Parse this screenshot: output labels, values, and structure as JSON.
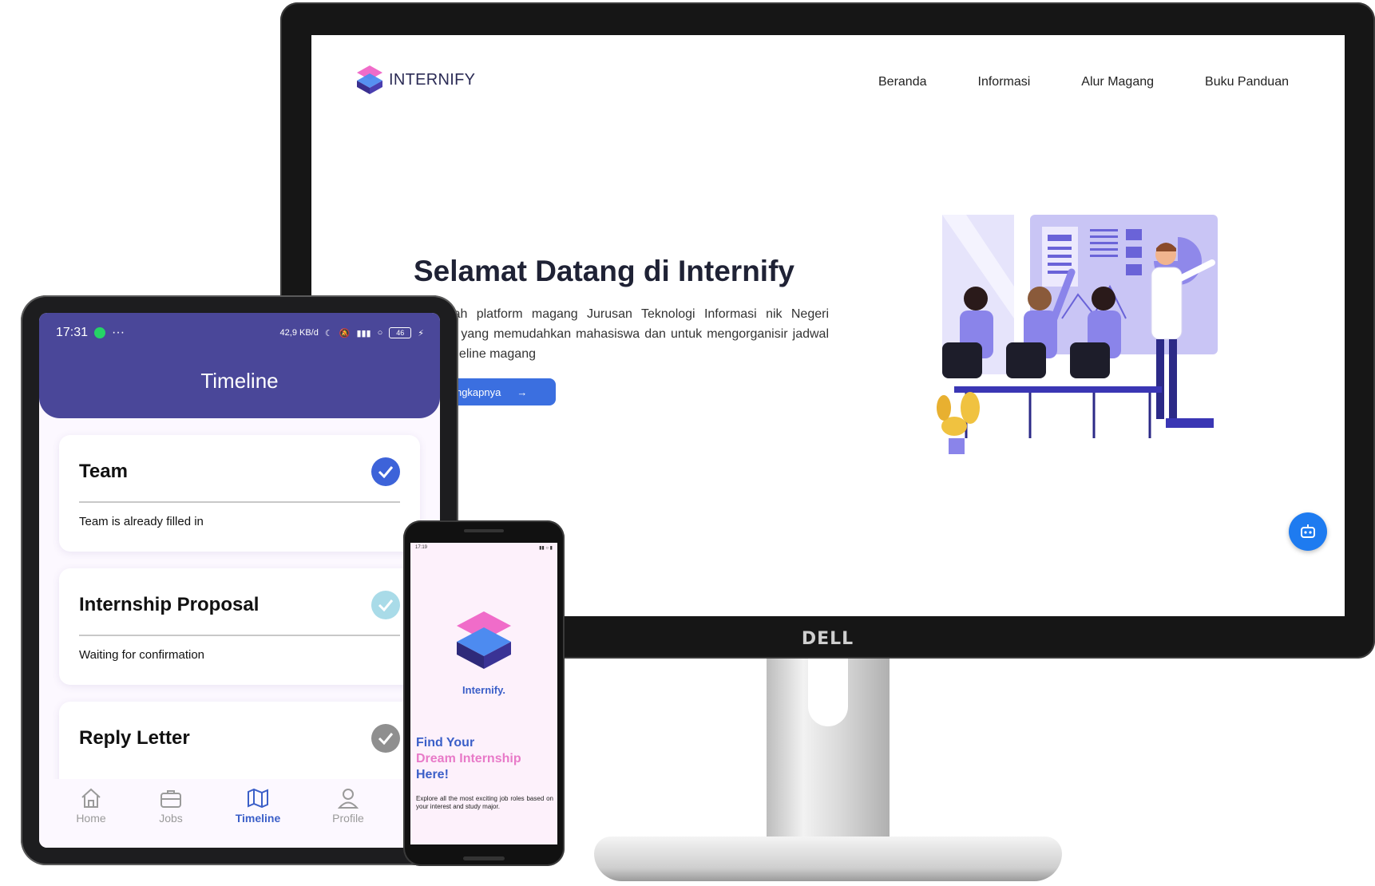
{
  "monitor": {
    "brand_logo": "DELL",
    "website": {
      "brand": "INTERNIFY",
      "nav": [
        "Beranda",
        "Informasi",
        "Alur Magang",
        "Buku Panduan"
      ],
      "hero": {
        "title": "Selamat Datang di Internify",
        "description": "y adalah platform magang Jurusan Teknologi Informasi nik Negeri Jember yang memudahkan mahasiswa dan untuk mengorganisir jadwal atau timeline magang",
        "button_label": "elengkapnya"
      }
    }
  },
  "tablet": {
    "status": {
      "time": "17:31",
      "dots": "···",
      "speed": "42,9 KB/d",
      "battery": "46"
    },
    "title": "Timeline",
    "cards": [
      {
        "title": "Team",
        "subtitle": "Team is already filled in",
        "status_color": "#3d63d9"
      },
      {
        "title": "Internship Proposal",
        "subtitle": "Waiting for confirmation",
        "status_color": "#a9dbe8"
      },
      {
        "title": "Reply Letter",
        "subtitle": "",
        "status_color": "#8f8f8f"
      }
    ],
    "tabs": [
      {
        "label": "Home",
        "icon": "home-icon"
      },
      {
        "label": "Jobs",
        "icon": "briefcase-icon"
      },
      {
        "label": "Timeline",
        "icon": "map-icon",
        "active": true
      },
      {
        "label": "Profile",
        "icon": "user-icon"
      }
    ]
  },
  "phone": {
    "status_time": "17:19",
    "brand": "Internify.",
    "headline_line1": "Find Your",
    "headline_line2": "Dream Internship",
    "headline_line3": "Here!",
    "description": "Explore all the most exciting job roles based on your interest and study major."
  },
  "colors": {
    "primary": "#4a4799",
    "accent_blue": "#3b5fc8",
    "pink": "#e87ac8",
    "fab": "#1e7bf0"
  }
}
